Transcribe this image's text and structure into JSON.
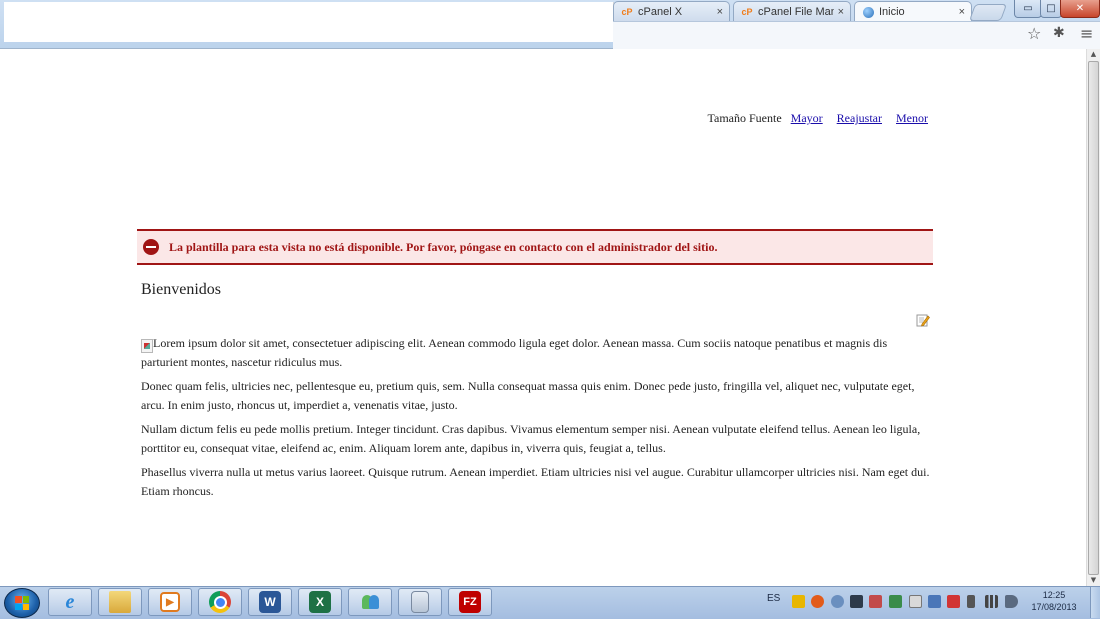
{
  "browser": {
    "tabs": [
      {
        "title": "cPanel X",
        "icon": "cpanel-icon",
        "active": false
      },
      {
        "title": "cPanel File Manag",
        "icon": "cpanel-icon",
        "active": false
      },
      {
        "title": "Inicio",
        "icon": "globe-icon",
        "active": true
      }
    ],
    "tab_icon_text": "cP",
    "tab_close": "×",
    "toolbar_icons": [
      "star-icon",
      "extension-icon",
      "menu-icon"
    ],
    "window_buttons": {
      "minimize": "▭",
      "maximize": "□",
      "close": "✕"
    }
  },
  "page": {
    "font_size": {
      "label": "Tamaño Fuente",
      "links": [
        "Mayor",
        "Reajustar",
        "Menor"
      ]
    },
    "alert": {
      "message": "La plantilla para esta vista no está disponible. Por favor, póngase en contacto con el administrador del sitio.",
      "color": "#a01515"
    },
    "title": "Bienvenidos",
    "paragraphs": [
      "Lorem ipsum dolor sit amet, consectetuer adipiscing elit. Aenean commodo ligula eget dolor. Aenean massa. Cum sociis natoque penatibus et magnis dis parturient montes, nascetur ridiculus mus.",
      "Donec quam felis, ultricies nec, pellentesque eu, pretium quis, sem. Nulla consequat massa quis enim. Donec pede justo, fringilla vel, aliquet nec, vulputate eget, arcu. In enim justo, rhoncus ut, imperdiet a, venenatis vitae, justo.",
      "Nullam dictum felis eu pede mollis pretium. Integer tincidunt. Cras dapibus. Vivamus elementum semper nisi. Aenean vulputate eleifend tellus. Aenean leo ligula, porttitor eu, consequat vitae, eleifend ac, enim. Aliquam lorem ante, dapibus in, viverra quis, feugiat a, tellus.",
      "Phasellus viverra nulla ut metus varius laoreet. Quisque rutrum. Aenean imperdiet. Etiam ultricies nisi vel augue. Curabitur ullamcorper ultricies nisi. Nam eget dui. Etiam rhoncus."
    ]
  },
  "taskbar": {
    "apps": [
      "internet-explorer-icon",
      "windows-explorer-icon",
      "media-player-icon",
      "chrome-icon",
      "word-icon",
      "excel-icon",
      "messenger-icon",
      "calculator-icon",
      "filezilla-icon"
    ],
    "app_letters": {
      "word": "W",
      "excel": "X",
      "filezilla": "FZ"
    },
    "language": "ES",
    "time": "12:25",
    "date": "17/08/2013"
  }
}
